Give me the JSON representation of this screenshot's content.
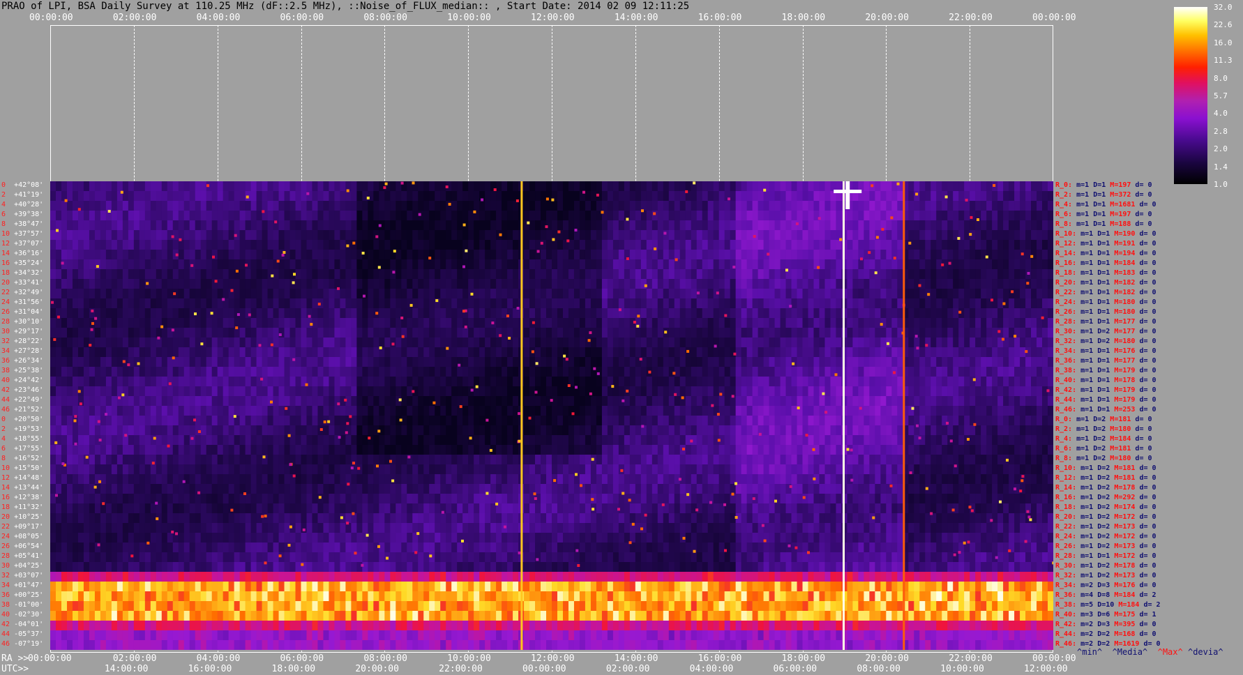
{
  "title": "PRAO of LPI, BSA Daily Survey at 110.25 MHz (dF::2.5 MHz), ::Noise_of_FLUX_median:: , Start Date: 2014 02 09 12:11:25",
  "top_axis_ticks": [
    "00:00:00",
    "02:00:00",
    "04:00:00",
    "06:00:00",
    "08:00:00",
    "10:00:00",
    "12:00:00",
    "14:00:00",
    "16:00:00",
    "18:00:00",
    "20:00:00",
    "22:00:00",
    "00:00:00"
  ],
  "ra_axis": {
    "label": "RA >>",
    "ticks": [
      "00:00:00",
      "02:00:00",
      "04:00:00",
      "06:00:00",
      "08:00:00",
      "10:00:00",
      "12:00:00",
      "14:00:00",
      "16:00:00",
      "18:00:00",
      "20:00:00",
      "22:00:00",
      "00:00:00"
    ]
  },
  "utc_axis": {
    "label": "UTC>>",
    "ticks": [
      "14:00:00",
      "16:00:00",
      "18:00:00",
      "20:00:00",
      "22:00:00",
      "00:00:00",
      "02:00:00",
      "04:00:00",
      "06:00:00",
      "08:00:00",
      "10:00:00",
      "12:00:00"
    ]
  },
  "colorbar": {
    "labels": [
      "32.0",
      "22.6",
      "16.0",
      "11.3",
      "8.0",
      "5.7",
      "4.0",
      "2.8",
      "2.0",
      "1.4",
      "1.0"
    ]
  },
  "legend": {
    "min": "^min^",
    "media": "^Media^",
    "max": "^Max^",
    "devia": "^devia^"
  },
  "chart_data": {
    "type": "heatmap",
    "title": "PRAO of LPI, BSA Daily Survey at 110.25 MHz (dF::2.5 MHz), ::Noise_of_FLUX_median:: , Start Date: 2014 02 09 12:11:25",
    "x_label": "RA",
    "x_range": [
      "00:00:00",
      "00:00:00"
    ],
    "color_scale": {
      "min": 1.0,
      "max": 32.0,
      "scale": "log"
    },
    "rows": [
      {
        "index": "0",
        "dec": "+42°08'"
      },
      {
        "index": "2",
        "dec": "+41°19'"
      },
      {
        "index": "4",
        "dec": "+40°28'"
      },
      {
        "index": "6",
        "dec": "+39°38'"
      },
      {
        "index": "8",
        "dec": "+38°47'"
      },
      {
        "index": "10",
        "dec": "+37°57'"
      },
      {
        "index": "12",
        "dec": "+37°07'"
      },
      {
        "index": "14",
        "dec": "+36°16'"
      },
      {
        "index": "16",
        "dec": "+35°24'"
      },
      {
        "index": "18",
        "dec": "+34°32'"
      },
      {
        "index": "20",
        "dec": "+33°41'"
      },
      {
        "index": "22",
        "dec": "+32°49'"
      },
      {
        "index": "24",
        "dec": "+31°56'"
      },
      {
        "index": "26",
        "dec": "+31°04'"
      },
      {
        "index": "28",
        "dec": "+30°10'"
      },
      {
        "index": "30",
        "dec": "+29°17'"
      },
      {
        "index": "32",
        "dec": "+28°22'"
      },
      {
        "index": "34",
        "dec": "+27°28'"
      },
      {
        "index": "36",
        "dec": "+26°34'"
      },
      {
        "index": "38",
        "dec": "+25°38'"
      },
      {
        "index": "40",
        "dec": "+24°42'"
      },
      {
        "index": "42",
        "dec": "+23°46'"
      },
      {
        "index": "44",
        "dec": "+22°49'"
      },
      {
        "index": "46",
        "dec": "+21°52'"
      },
      {
        "index": "0",
        "dec": "+20°50'"
      },
      {
        "index": "2",
        "dec": "+19°53'"
      },
      {
        "index": "4",
        "dec": "+18°55'"
      },
      {
        "index": "6",
        "dec": "+17°55'"
      },
      {
        "index": "8",
        "dec": "+16°52'"
      },
      {
        "index": "10",
        "dec": "+15°50'"
      },
      {
        "index": "12",
        "dec": "+14°48'"
      },
      {
        "index": "14",
        "dec": "+13°44'"
      },
      {
        "index": "16",
        "dec": "+12°38'"
      },
      {
        "index": "18",
        "dec": "+11°32'"
      },
      {
        "index": "20",
        "dec": "+10°25'"
      },
      {
        "index": "22",
        "dec": "+09°17'"
      },
      {
        "index": "24",
        "dec": "+08°05'"
      },
      {
        "index": "26",
        "dec": "+06°54'"
      },
      {
        "index": "28",
        "dec": "+05°41'"
      },
      {
        "index": "30",
        "dec": "+04°25'"
      },
      {
        "index": "32",
        "dec": "+03°07'"
      },
      {
        "index": "34",
        "dec": "+01°47'"
      },
      {
        "index": "36",
        "dec": "+00°25'"
      },
      {
        "index": "38",
        "dec": "-01°00'"
      },
      {
        "index": "40",
        "dec": "-02°30'"
      },
      {
        "index": "42",
        "dec": "-04°01'"
      },
      {
        "index": "44",
        "dec": "-05°37'"
      },
      {
        "index": "46",
        "dec": "-07°19'"
      }
    ],
    "row_stats": [
      {
        "r": "R_0:",
        "m": "m=1",
        "D": "D=1",
        "M": "M=197",
        "d": "d= 0"
      },
      {
        "r": "R_2:",
        "m": "m=1",
        "D": "D=1",
        "M": "M=372",
        "d": "d= 0"
      },
      {
        "r": "R_4:",
        "m": "m=1",
        "D": "D=1",
        "M": "M=1681",
        "d": "d= 0"
      },
      {
        "r": "R_6:",
        "m": "m=1",
        "D": "D=1",
        "M": "M=197",
        "d": "d= 0"
      },
      {
        "r": "R_8:",
        "m": "m=1",
        "D": "D=1",
        "M": "M=188",
        "d": "d= 0"
      },
      {
        "r": "R_10:",
        "m": "m=1",
        "D": "D=1",
        "M": "M=190",
        "d": "d= 0"
      },
      {
        "r": "R_12:",
        "m": "m=1",
        "D": "D=1",
        "M": "M=191",
        "d": "d= 0"
      },
      {
        "r": "R_14:",
        "m": "m=1",
        "D": "D=1",
        "M": "M=194",
        "d": "d= 0"
      },
      {
        "r": "R_16:",
        "m": "m=1",
        "D": "D=1",
        "M": "M=184",
        "d": "d= 0"
      },
      {
        "r": "R_18:",
        "m": "m=1",
        "D": "D=1",
        "M": "M=183",
        "d": "d= 0"
      },
      {
        "r": "R_20:",
        "m": "m=1",
        "D": "D=1",
        "M": "M=182",
        "d": "d= 0"
      },
      {
        "r": "R_22:",
        "m": "m=1",
        "D": "D=1",
        "M": "M=182",
        "d": "d= 0"
      },
      {
        "r": "R_24:",
        "m": "m=1",
        "D": "D=1",
        "M": "M=180",
        "d": "d= 0"
      },
      {
        "r": "R_26:",
        "m": "m=1",
        "D": "D=1",
        "M": "M=180",
        "d": "d= 0"
      },
      {
        "r": "R_28:",
        "m": "m=1",
        "D": "D=1",
        "M": "M=177",
        "d": "d= 0"
      },
      {
        "r": "R_30:",
        "m": "m=1",
        "D": "D=2",
        "M": "M=177",
        "d": "d= 0"
      },
      {
        "r": "R_32:",
        "m": "m=1",
        "D": "D=2",
        "M": "M=180",
        "d": "d= 0"
      },
      {
        "r": "R_34:",
        "m": "m=1",
        "D": "D=1",
        "M": "M=176",
        "d": "d= 0"
      },
      {
        "r": "R_36:",
        "m": "m=1",
        "D": "D=1",
        "M": "M=177",
        "d": "d= 0"
      },
      {
        "r": "R_38:",
        "m": "m=1",
        "D": "D=1",
        "M": "M=179",
        "d": "d= 0"
      },
      {
        "r": "R_40:",
        "m": "m=1",
        "D": "D=1",
        "M": "M=178",
        "d": "d= 0"
      },
      {
        "r": "R_42:",
        "m": "m=1",
        "D": "D=1",
        "M": "M=179",
        "d": "d= 0"
      },
      {
        "r": "R_44:",
        "m": "m=1",
        "D": "D=1",
        "M": "M=179",
        "d": "d= 0"
      },
      {
        "r": "R_46:",
        "m": "m=1",
        "D": "D=1",
        "M": "M=253",
        "d": "d= 0"
      },
      {
        "r": "R_0:",
        "m": "m=1",
        "D": "D=2",
        "M": "M=181",
        "d": "d= 0"
      },
      {
        "r": "R_2:",
        "m": "m=1",
        "D": "D=2",
        "M": "M=180",
        "d": "d= 0"
      },
      {
        "r": "R_4:",
        "m": "m=1",
        "D": "D=2",
        "M": "M=184",
        "d": "d= 0"
      },
      {
        "r": "R_6:",
        "m": "m=1",
        "D": "D=2",
        "M": "M=181",
        "d": "d= 0"
      },
      {
        "r": "R_8:",
        "m": "m=1",
        "D": "D=2",
        "M": "M=180",
        "d": "d= 0"
      },
      {
        "r": "R_10:",
        "m": "m=1",
        "D": "D=2",
        "M": "M=181",
        "d": "d= 0"
      },
      {
        "r": "R_12:",
        "m": "m=1",
        "D": "D=2",
        "M": "M=181",
        "d": "d= 0"
      },
      {
        "r": "R_14:",
        "m": "m=1",
        "D": "D=2",
        "M": "M=178",
        "d": "d= 0"
      },
      {
        "r": "R_16:",
        "m": "m=1",
        "D": "D=2",
        "M": "M=292",
        "d": "d= 0"
      },
      {
        "r": "R_18:",
        "m": "m=1",
        "D": "D=2",
        "M": "M=174",
        "d": "d= 0"
      },
      {
        "r": "R_20:",
        "m": "m=1",
        "D": "D=2",
        "M": "M=172",
        "d": "d= 0"
      },
      {
        "r": "R_22:",
        "m": "m=1",
        "D": "D=2",
        "M": "M=173",
        "d": "d= 0"
      },
      {
        "r": "R_24:",
        "m": "m=1",
        "D": "D=2",
        "M": "M=172",
        "d": "d= 0"
      },
      {
        "r": "R_26:",
        "m": "m=1",
        "D": "D=2",
        "M": "M=173",
        "d": "d= 0"
      },
      {
        "r": "R_28:",
        "m": "m=1",
        "D": "D=1",
        "M": "M=172",
        "d": "d= 0"
      },
      {
        "r": "R_30:",
        "m": "m=1",
        "D": "D=2",
        "M": "M=178",
        "d": "d= 0"
      },
      {
        "r": "R_32:",
        "m": "m=1",
        "D": "D=2",
        "M": "M=173",
        "d": "d= 0"
      },
      {
        "r": "R_34:",
        "m": "m=2",
        "D": "D=3",
        "M": "M=176",
        "d": "d= 0"
      },
      {
        "r": "R_36:",
        "m": "m=4",
        "D": "D=8",
        "M": "M=184",
        "d": "d= 2"
      },
      {
        "r": "R_38:",
        "m": "m=5",
        "D": "D=10",
        "M": "M=184",
        "d": "d= 2"
      },
      {
        "r": "R_40:",
        "m": "m=3",
        "D": "D=6",
        "M": "M=175",
        "d": "d= 1"
      },
      {
        "r": "R_42:",
        "m": "m=2",
        "D": "D=3",
        "M": "M=395",
        "d": "d= 0"
      },
      {
        "r": "R_44:",
        "m": "m=2",
        "D": "D=2",
        "M": "M=168",
        "d": "d= 0"
      },
      {
        "r": "R_46:",
        "m": "m=2",
        "D": "D=2",
        "M": "M=1619",
        "d": "d= 0"
      }
    ]
  }
}
